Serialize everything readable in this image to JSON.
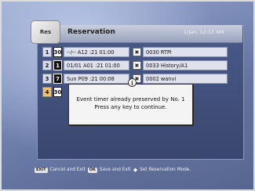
{
  "header": {
    "logo_text": "Res",
    "title": "Reservation",
    "datetime": "1/Jan. 12:17 AM"
  },
  "rows": [
    {
      "num": "1",
      "day": "30",
      "time": "--/-- A12 :21  01:00",
      "channel": "0030 RTPi"
    },
    {
      "num": "2",
      "day": "1",
      "time": "01/01 A01 :21  01:00",
      "channel": "0033 History/A1"
    },
    {
      "num": "3",
      "day": "7",
      "time": "Sun      P09 :21  00:08",
      "channel": "0002 wanvi"
    },
    {
      "num": "4",
      "day": "30",
      "time": "",
      "channel": ""
    }
  ],
  "dialog": {
    "line1": "Event timer already preserved by No. 1",
    "line2": "Press any key to continue."
  },
  "footer": {
    "exit_key": "EXIT",
    "exit_label": "Cancel and Exit",
    "ok_key": "OK",
    "ok_label": "Save and Exit",
    "arrow_label": "Set Reservation Mode."
  }
}
